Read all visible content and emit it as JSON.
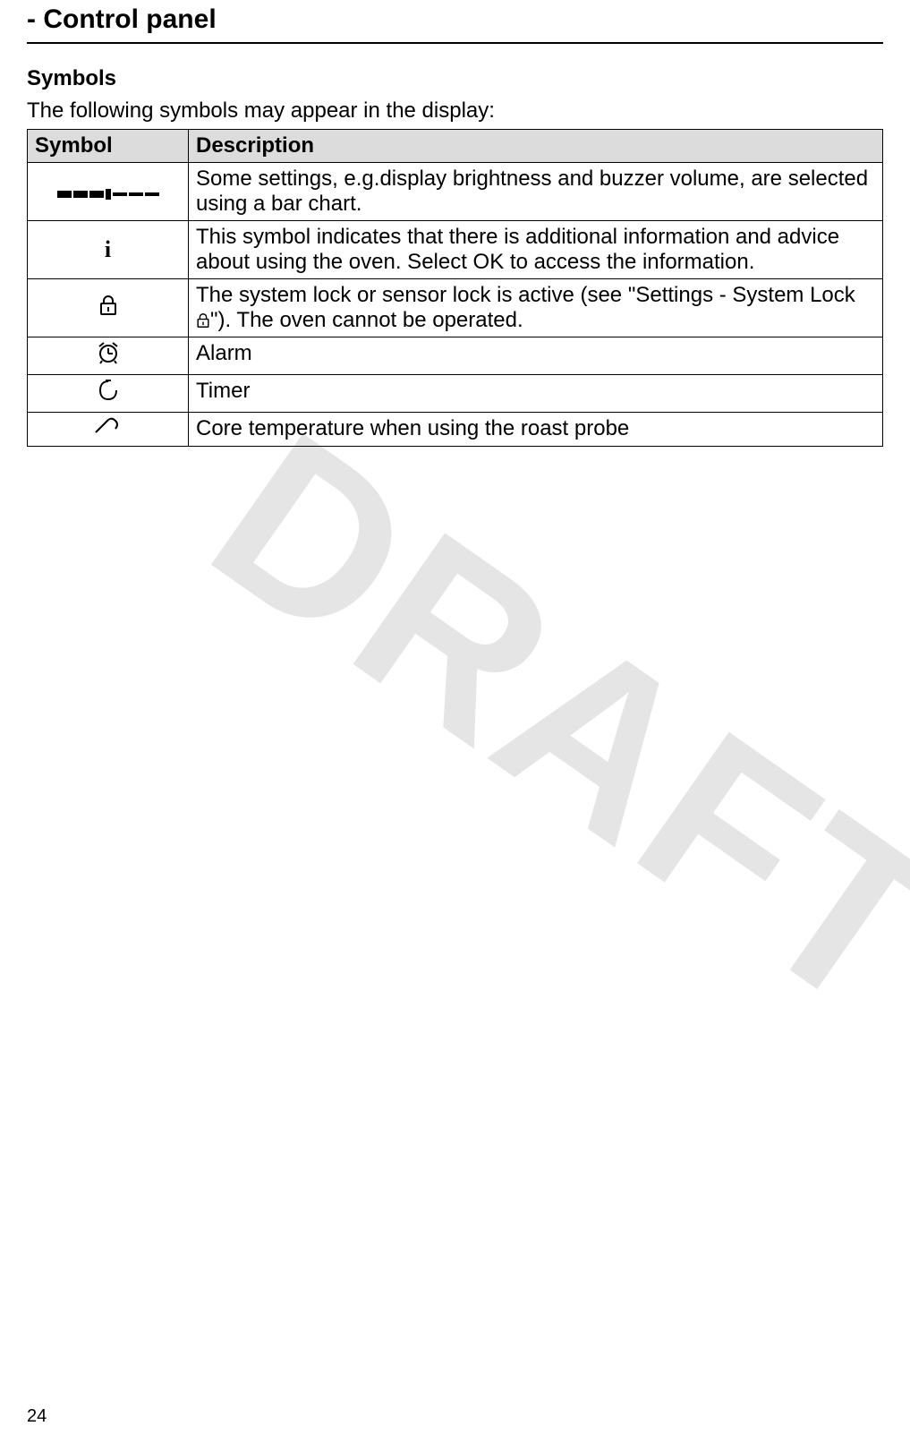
{
  "header": {
    "title": "- Control panel"
  },
  "section": {
    "subheading": "Symbols",
    "intro": "The following symbols may appear in the display:"
  },
  "table": {
    "headers": {
      "symbol": "Symbol",
      "description": "Description"
    },
    "rows": [
      {
        "symbol_name": "bar-chart-icon",
        "description": "Some settings, e.g.display brightness and buzzer volume, are selected using a bar chart."
      },
      {
        "symbol_name": "info-icon",
        "description": "This symbol indicates that there is additional information and advice about using the oven. Select OK to access the information."
      },
      {
        "symbol_name": "lock-icon",
        "description_prefix": "The system lock or sensor lock is active (see \"Settings - System Lock ",
        "description_suffix": "\"). The oven cannot be operated."
      },
      {
        "symbol_name": "alarm-icon",
        "description": "Alarm"
      },
      {
        "symbol_name": "timer-icon",
        "description": "Timer"
      },
      {
        "symbol_name": "probe-icon",
        "description": "Core temperature when using the roast probe"
      }
    ]
  },
  "watermark": "DRAFT",
  "page_number": "24"
}
